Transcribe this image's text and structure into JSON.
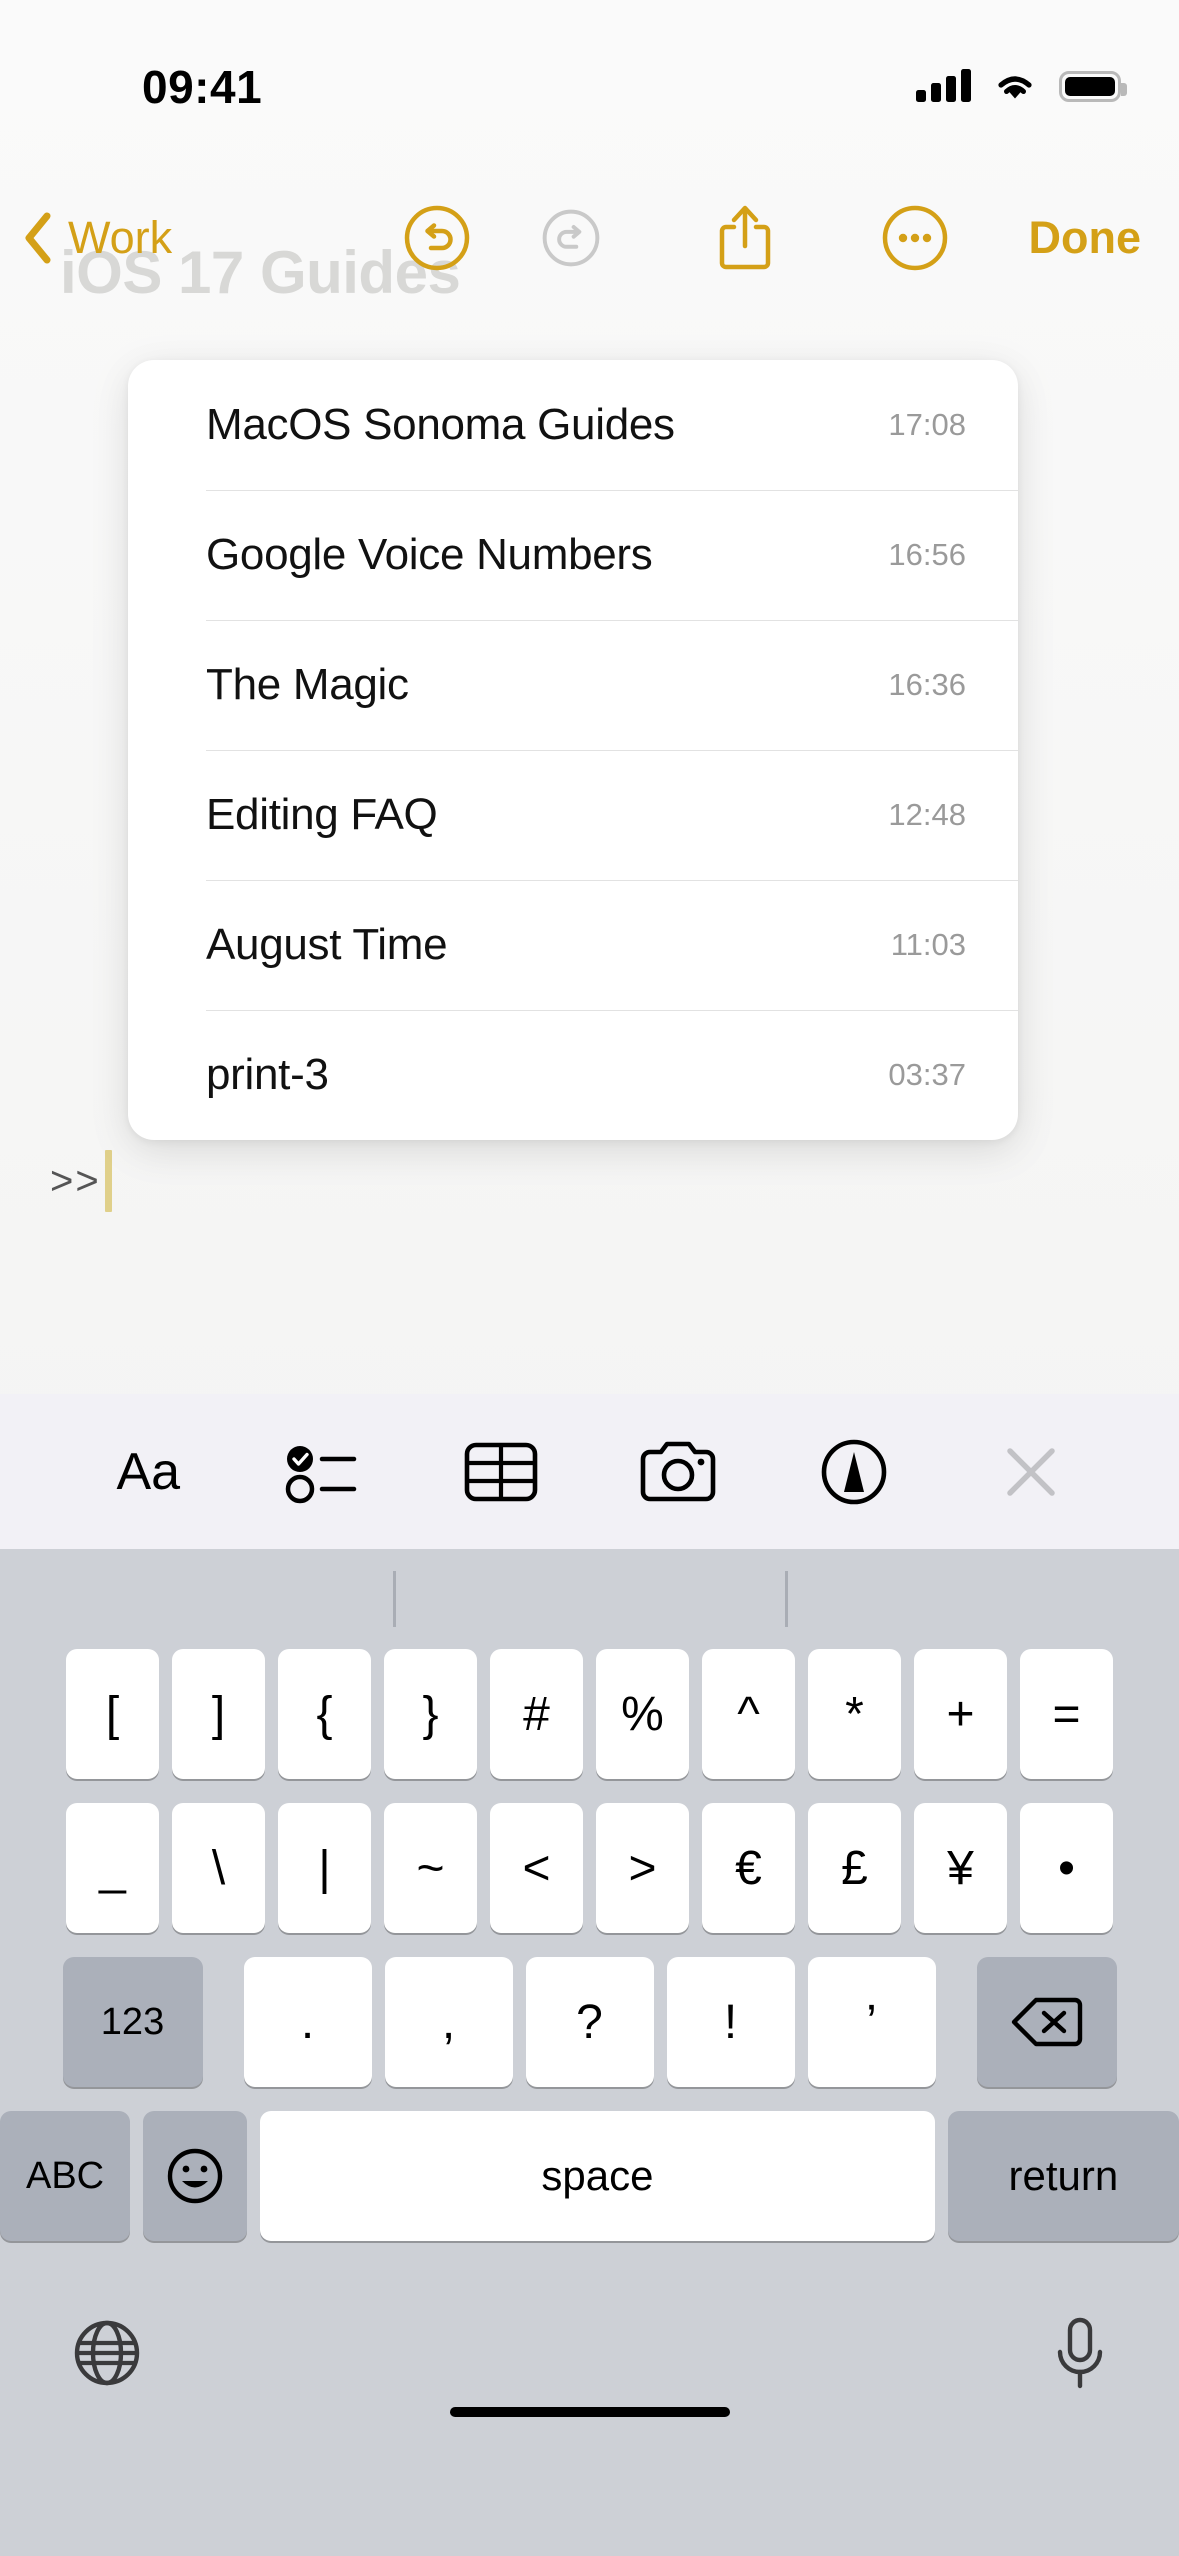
{
  "status_bar": {
    "time": "09:41",
    "cellular_icon": "cellular-bars-icon",
    "wifi_icon": "wifi-icon",
    "battery_icon": "battery-full-icon"
  },
  "toolbar": {
    "back_label": "Work",
    "undo_icon": "undo-icon",
    "redo_icon": "redo-icon",
    "share_icon": "share-icon",
    "more_icon": "more-ellipsis-icon",
    "done_label": "Done",
    "accent_color": "#d4a017",
    "disabled_color": "#c9c9c9"
  },
  "note": {
    "ghost_title": "iOS 17 Guides",
    "body_text": ">>"
  },
  "popover": {
    "rows": [
      {
        "title": "MacOS Sonoma Guides",
        "time": "17:08"
      },
      {
        "title": "Google Voice Numbers",
        "time": "16:56"
      },
      {
        "title": "The Magic",
        "time": "16:36"
      },
      {
        "title": "Editing FAQ",
        "time": "12:48"
      },
      {
        "title": "August Time",
        "time": "11:03"
      },
      {
        "title": "print-3",
        "time": "03:37"
      }
    ]
  },
  "keyboard_accessory": {
    "format_label": "Aa",
    "items": [
      "format-aa-icon",
      "checklist-icon",
      "table-icon",
      "camera-icon",
      "markup-pen-icon",
      "close-keyboard-icon"
    ]
  },
  "keyboard": {
    "row1": [
      "[",
      "]",
      "{",
      "}",
      "#",
      "%",
      "^",
      "*",
      "+",
      "="
    ],
    "row2": [
      "_",
      "\\",
      "|",
      "~",
      "<",
      ">",
      "€",
      "£",
      "¥",
      "•"
    ],
    "row3_numeric_label": "123",
    "row3": [
      ".",
      ",",
      "?",
      "!",
      "’"
    ],
    "row3_backspace_icon": "backspace-icon",
    "row4_abc_label": "ABC",
    "row4_emoji_icon": "emoji-smiley-icon",
    "row4_space_label": "space",
    "row4_return_label": "return",
    "globe_icon": "globe-icon",
    "dictation_icon": "microphone-icon"
  }
}
